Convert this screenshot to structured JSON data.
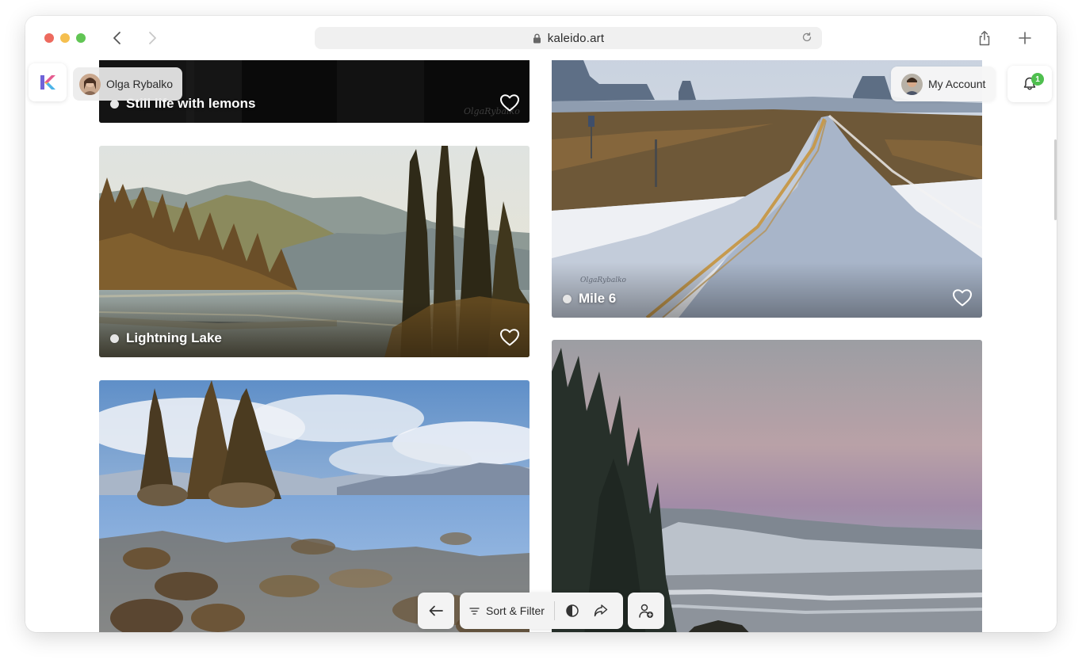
{
  "browser": {
    "url": "kaleido.art",
    "traffic_lights": [
      "#ed6a5e",
      "#f5bf4f",
      "#61c554"
    ]
  },
  "header": {
    "logo_icon": "kaleido-logo-icon",
    "artist_name": "Olga Rybalko",
    "account_label": "My Account",
    "notifications_count": "1"
  },
  "gallery": {
    "cards": [
      {
        "title": "Still life with lemons",
        "icon": "heart-icon"
      },
      {
        "title": "Lightning Lake",
        "icon": "heart-icon"
      },
      {
        "title": "Mile 6",
        "icon": "heart-icon"
      }
    ]
  },
  "toolbar": {
    "sort_filter_label": "Sort & Filter",
    "icons": [
      "back-arrow-icon",
      "filter-lines-icon",
      "contrast-icon",
      "share-icon",
      "add-user-icon"
    ]
  },
  "colors": {
    "badge": "#4fbf4f",
    "pill_bg": "#ebebeb"
  }
}
